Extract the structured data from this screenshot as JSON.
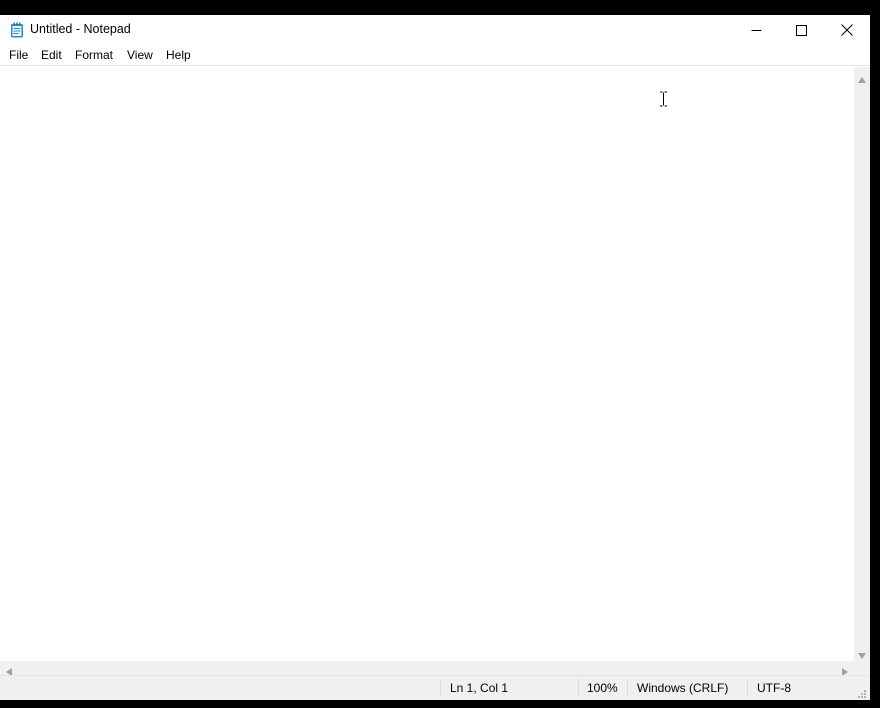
{
  "window": {
    "title": "Untitled - Notepad"
  },
  "menu": {
    "file": "File",
    "edit": "Edit",
    "format": "Format",
    "view": "View",
    "help": "Help"
  },
  "editor": {
    "content": ""
  },
  "status": {
    "position": "Ln 1, Col 1",
    "zoom": "100%",
    "line_ending": "Windows (CRLF)",
    "encoding": "UTF-8"
  },
  "icons": {
    "app": "notepad-icon",
    "minimize": "minimize-icon",
    "maximize": "maximize-icon",
    "close": "close-icon",
    "cursor": "i-beam-cursor-icon"
  },
  "colors": {
    "titlebar_bg": "#ffffff",
    "statusbar_bg": "#f0f0f0",
    "scrollbar_bg": "#f0f0f0",
    "app_icon_accent": "#2a8fc9"
  }
}
